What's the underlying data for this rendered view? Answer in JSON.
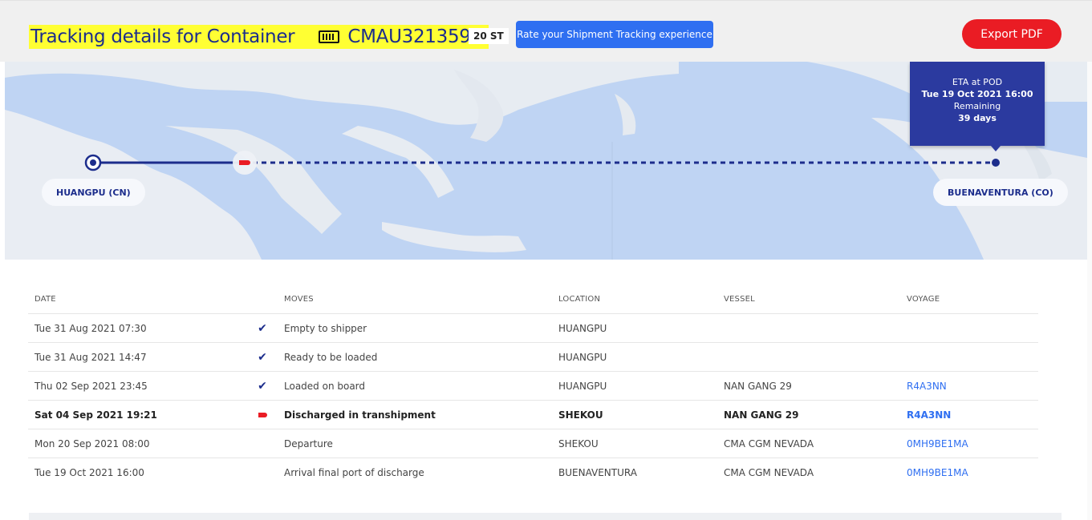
{
  "header": {
    "title": "Tracking details for Container",
    "container_icon": "container-icon",
    "container_number": "CMAU3213597",
    "size_type": "20 ST",
    "rate_button": "Rate your Shipment Tracking experience",
    "export_button": "Export PDF"
  },
  "map": {
    "origin_label": "HUANGPU (CN)",
    "destination_label": "BUENAVENTURA (CO)",
    "eta": {
      "title": "ETA at POD",
      "datetime": "Tue 19 Oct 2021 16:00",
      "remaining_label": "Remaining",
      "remaining_value": "39 days"
    }
  },
  "table": {
    "headers": {
      "date": "DATE",
      "moves": "MOVES",
      "location": "LOCATION",
      "vessel": "VESSEL",
      "voyage": "VOYAGE"
    },
    "rows": [
      {
        "date": "Tue 31 Aug 2021 07:30",
        "status": "check-icon",
        "move": "Empty to shipper",
        "location": "HUANGPU",
        "vessel": "",
        "voyage": ""
      },
      {
        "date": "Tue 31 Aug 2021 14:47",
        "status": "check-icon",
        "move": "Ready to be loaded",
        "location": "HUANGPU",
        "vessel": "",
        "voyage": ""
      },
      {
        "date": "Thu 02 Sep 2021 23:45",
        "status": "check-icon",
        "move": "Loaded on board",
        "location": "HUANGPU",
        "vessel": "NAN GANG 29",
        "voyage": "R4A3NN"
      },
      {
        "date": "Sat 04 Sep 2021 19:21",
        "status": "current-location-icon",
        "move": "Discharged in transhipment",
        "location": "SHEKOU",
        "vessel": "NAN GANG 29",
        "voyage": "R4A3NN"
      },
      {
        "date": "Mon 20 Sep 2021 08:00",
        "status": "",
        "move": "Departure",
        "location": "SHEKOU",
        "vessel": "CMA CGM NEVADA",
        "voyage": "0MH9BE1MA"
      },
      {
        "date": "Tue 19 Oct 2021 16:00",
        "status": "",
        "move": "Arrival final port of discharge",
        "location": "BUENAVENTURA",
        "vessel": "CMA CGM NEVADA",
        "voyage": "0MH9BE1MA"
      }
    ]
  },
  "colors": {
    "brand_blue": "#1c2d8c",
    "button_blue": "#2f6ff1",
    "export_red": "#ea1c24",
    "highlight_yellow": "#ffff33",
    "map_water": "#bfd4f3"
  }
}
